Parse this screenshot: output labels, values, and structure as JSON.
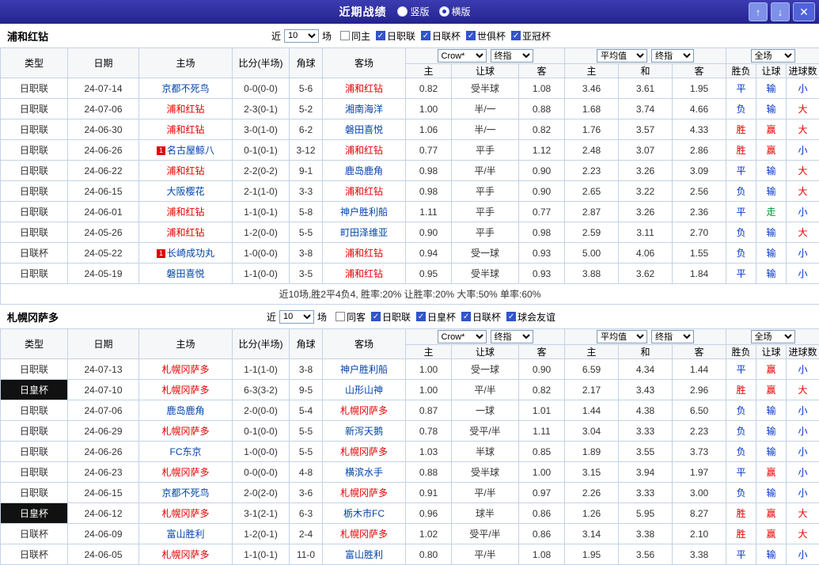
{
  "palette": {
    "topbar_bg": "#2b2b9c",
    "type_green": "#2e9e2e",
    "type_black": "#111111",
    "team_self_red": "#e50000",
    "team_opp_blue": "#0044aa",
    "score_red": "#e50000",
    "result_red": "#e50000",
    "result_blue": "#0033cc",
    "result_green": "#009933",
    "checkbox_blue": "#3355cc",
    "grid_border": "#c3d3e6"
  },
  "icons": {
    "check": "✓"
  },
  "titlebar": {
    "title": "近期战绩",
    "radios": [
      {
        "label": "竖版",
        "checked": false
      },
      {
        "label": "横版",
        "checked": true
      }
    ],
    "up_icon": "↑",
    "down_icon": "↓",
    "close_icon": "✕"
  },
  "sections": [
    {
      "team": "浦和红钻",
      "near_label": "近",
      "count": "10",
      "games_label": "场",
      "filters": [
        {
          "label": "同主",
          "checked": false
        },
        {
          "label": "日职联",
          "checked": true
        },
        {
          "label": "日联杯",
          "checked": true
        },
        {
          "label": "世俱杯",
          "checked": true
        },
        {
          "label": "亚冠杯",
          "checked": true
        }
      ],
      "header": {
        "cols": [
          "类型",
          "日期",
          "主场",
          "比分(半场)",
          "角球",
          "客场"
        ],
        "odds_selects": [
          "Crow*",
          "终指"
        ],
        "avg_selects": [
          "平均值",
          "终指"
        ],
        "full_select": "全场",
        "sub": [
          "主",
          "让球",
          "客",
          "主",
          "和",
          "客",
          "胜负",
          "让球",
          "进球数"
        ]
      },
      "rows": [
        {
          "type": "日职联",
          "type_dark": false,
          "date": "24-07-14",
          "home": "京都不死鸟",
          "home_self": false,
          "home_badge": "",
          "score": "0-0(0-0)",
          "corner": "5-6",
          "away": "浦和红钻",
          "away_self": true,
          "odds_home": "0.82",
          "handicap": "受半球",
          "odds_away": "1.08",
          "avg_home": "3.46",
          "avg_draw": "3.61",
          "avg_away": "1.95",
          "result": "平",
          "handicap_result": "输",
          "goals_result": "小"
        },
        {
          "type": "日职联",
          "type_dark": false,
          "date": "24-07-06",
          "home": "浦和红钻",
          "home_self": true,
          "home_badge": "",
          "score": "2-3(0-1)",
          "corner": "5-2",
          "away": "湘南海洋",
          "away_self": false,
          "odds_home": "1.00",
          "handicap": "半/一",
          "odds_away": "0.88",
          "avg_home": "1.68",
          "avg_draw": "3.74",
          "avg_away": "4.66",
          "result": "负",
          "handicap_result": "输",
          "goals_result": "大"
        },
        {
          "type": "日职联",
          "type_dark": false,
          "date": "24-06-30",
          "home": "浦和红钻",
          "home_self": true,
          "home_badge": "",
          "score": "3-0(1-0)",
          "corner": "6-2",
          "away": "磐田喜悦",
          "away_self": false,
          "odds_home": "1.06",
          "handicap": "半/一",
          "odds_away": "0.82",
          "avg_home": "1.76",
          "avg_draw": "3.57",
          "avg_away": "4.33",
          "result": "胜",
          "handicap_result": "赢",
          "goals_result": "大"
        },
        {
          "type": "日职联",
          "type_dark": false,
          "date": "24-06-26",
          "home": "名古屋鲸八",
          "home_self": false,
          "home_badge": "1",
          "score": "0-1(0-1)",
          "corner": "3-12",
          "away": "浦和红钻",
          "away_self": true,
          "odds_home": "0.77",
          "handicap": "平手",
          "odds_away": "1.12",
          "avg_home": "2.48",
          "avg_draw": "3.07",
          "avg_away": "2.86",
          "result": "胜",
          "handicap_result": "赢",
          "goals_result": "小"
        },
        {
          "type": "日职联",
          "type_dark": false,
          "date": "24-06-22",
          "home": "浦和红钻",
          "home_self": true,
          "home_badge": "",
          "score": "2-2(0-2)",
          "corner": "9-1",
          "away": "鹿岛鹿角",
          "away_self": false,
          "odds_home": "0.98",
          "handicap": "平/半",
          "odds_away": "0.90",
          "avg_home": "2.23",
          "avg_draw": "3.26",
          "avg_away": "3.09",
          "result": "平",
          "handicap_result": "输",
          "goals_result": "大"
        },
        {
          "type": "日职联",
          "type_dark": false,
          "date": "24-06-15",
          "home": "大阪樱花",
          "home_self": false,
          "home_badge": "",
          "score": "2-1(1-0)",
          "corner": "3-3",
          "away": "浦和红钻",
          "away_self": true,
          "odds_home": "0.98",
          "handicap": "平手",
          "odds_away": "0.90",
          "avg_home": "2.65",
          "avg_draw": "3.22",
          "avg_away": "2.56",
          "result": "负",
          "handicap_result": "输",
          "goals_result": "大"
        },
        {
          "type": "日职联",
          "type_dark": false,
          "date": "24-06-01",
          "home": "浦和红钻",
          "home_self": true,
          "home_badge": "",
          "score": "1-1(0-1)",
          "corner": "5-8",
          "away": "神户胜利船",
          "away_self": false,
          "odds_home": "1.11",
          "handicap": "平手",
          "odds_away": "0.77",
          "avg_home": "2.87",
          "avg_draw": "3.26",
          "avg_away": "2.36",
          "result": "平",
          "handicap_result": "走",
          "goals_result": "小"
        },
        {
          "type": "日职联",
          "type_dark": false,
          "date": "24-05-26",
          "home": "浦和红钻",
          "home_self": true,
          "home_badge": "",
          "score": "1-2(0-0)",
          "corner": "5-5",
          "away": "町田泽维亚",
          "away_self": false,
          "odds_home": "0.90",
          "handicap": "平手",
          "odds_away": "0.98",
          "avg_home": "2.59",
          "avg_draw": "3.11",
          "avg_away": "2.70",
          "result": "负",
          "handicap_result": "输",
          "goals_result": "大"
        },
        {
          "type": "日联杯",
          "type_dark": false,
          "date": "24-05-22",
          "home": "长崎成功丸",
          "home_self": false,
          "home_badge": "1",
          "score": "1-0(0-0)",
          "corner": "3-8",
          "away": "浦和红钻",
          "away_self": true,
          "odds_home": "0.94",
          "handicap": "受一球",
          "odds_away": "0.93",
          "avg_home": "5.00",
          "avg_draw": "4.06",
          "avg_away": "1.55",
          "result": "负",
          "handicap_result": "输",
          "goals_result": "小"
        },
        {
          "type": "日职联",
          "type_dark": false,
          "date": "24-05-19",
          "home": "磐田喜悦",
          "home_self": false,
          "home_badge": "",
          "score": "1-1(0-0)",
          "corner": "3-5",
          "away": "浦和红钻",
          "away_self": true,
          "odds_home": "0.95",
          "handicap": "受半球",
          "odds_away": "0.93",
          "avg_home": "3.88",
          "avg_draw": "3.62",
          "avg_away": "1.84",
          "result": "平",
          "handicap_result": "输",
          "goals_result": "小"
        }
      ],
      "summary": "近10场,胜2平4负4, 胜率:20% 让胜率:20% 大率:50% 单率:60%"
    },
    {
      "team": "札幌冈萨多",
      "near_label": "近",
      "count": "10",
      "games_label": "场",
      "filters": [
        {
          "label": "同客",
          "checked": false
        },
        {
          "label": "日职联",
          "checked": true
        },
        {
          "label": "日皇杯",
          "checked": true
        },
        {
          "label": "日联杯",
          "checked": true
        },
        {
          "label": "球会友谊",
          "checked": true
        }
      ],
      "header": {
        "cols": [
          "类型",
          "日期",
          "主场",
          "比分(半场)",
          "角球",
          "客场"
        ],
        "odds_selects": [
          "Crow*",
          "终指"
        ],
        "avg_selects": [
          "平均值",
          "终指"
        ],
        "full_select": "全场",
        "sub": [
          "主",
          "让球",
          "客",
          "主",
          "和",
          "客",
          "胜负",
          "让球",
          "进球数"
        ]
      },
      "rows": [
        {
          "type": "日职联",
          "type_dark": false,
          "date": "24-07-13",
          "home": "札幌冈萨多",
          "home_self": true,
          "home_badge": "",
          "score": "1-1(1-0)",
          "corner": "3-8",
          "away": "神户胜利船",
          "away_self": false,
          "odds_home": "1.00",
          "handicap": "受一球",
          "odds_away": "0.90",
          "avg_home": "6.59",
          "avg_draw": "4.34",
          "avg_away": "1.44",
          "result": "平",
          "handicap_result": "赢",
          "goals_result": "小"
        },
        {
          "type": "日皇杯",
          "type_dark": true,
          "date": "24-07-10",
          "home": "札幌冈萨多",
          "home_self": true,
          "home_badge": "",
          "score": "6-3(3-2)",
          "corner": "9-5",
          "away": "山形山神",
          "away_self": false,
          "odds_home": "1.00",
          "handicap": "平/半",
          "odds_away": "0.82",
          "avg_home": "2.17",
          "avg_draw": "3.43",
          "avg_away": "2.96",
          "result": "胜",
          "handicap_result": "赢",
          "goals_result": "大"
        },
        {
          "type": "日职联",
          "type_dark": false,
          "date": "24-07-06",
          "home": "鹿岛鹿角",
          "home_self": false,
          "home_badge": "",
          "score": "2-0(0-0)",
          "corner": "5-4",
          "away": "札幌冈萨多",
          "away_self": true,
          "odds_home": "0.87",
          "handicap": "一球",
          "odds_away": "1.01",
          "avg_home": "1.44",
          "avg_draw": "4.38",
          "avg_away": "6.50",
          "result": "负",
          "handicap_result": "输",
          "goals_result": "小"
        },
        {
          "type": "日职联",
          "type_dark": false,
          "date": "24-06-29",
          "home": "札幌冈萨多",
          "home_self": true,
          "home_badge": "",
          "score": "0-1(0-0)",
          "corner": "5-5",
          "away": "新泻天鹅",
          "away_self": false,
          "odds_home": "0.78",
          "handicap": "受平/半",
          "odds_away": "1.11",
          "avg_home": "3.04",
          "avg_draw": "3.33",
          "avg_away": "2.23",
          "result": "负",
          "handicap_result": "输",
          "goals_result": "小"
        },
        {
          "type": "日职联",
          "type_dark": false,
          "date": "24-06-26",
          "home": "FC东京",
          "home_self": false,
          "home_badge": "",
          "score": "1-0(0-0)",
          "corner": "5-5",
          "away": "札幌冈萨多",
          "away_self": true,
          "odds_home": "1.03",
          "handicap": "半球",
          "odds_away": "0.85",
          "avg_home": "1.89",
          "avg_draw": "3.55",
          "avg_away": "3.73",
          "result": "负",
          "handicap_result": "输",
          "goals_result": "小"
        },
        {
          "type": "日职联",
          "type_dark": false,
          "date": "24-06-23",
          "home": "札幌冈萨多",
          "home_self": true,
          "home_badge": "",
          "score": "0-0(0-0)",
          "corner": "4-8",
          "away": "横滨水手",
          "away_self": false,
          "odds_home": "0.88",
          "handicap": "受半球",
          "odds_away": "1.00",
          "avg_home": "3.15",
          "avg_draw": "3.94",
          "avg_away": "1.97",
          "result": "平",
          "handicap_result": "赢",
          "goals_result": "小"
        },
        {
          "type": "日职联",
          "type_dark": false,
          "date": "24-06-15",
          "home": "京都不死鸟",
          "home_self": false,
          "home_badge": "",
          "score": "2-0(2-0)",
          "corner": "3-6",
          "away": "札幌冈萨多",
          "away_self": true,
          "odds_home": "0.91",
          "handicap": "平/半",
          "odds_away": "0.97",
          "avg_home": "2.26",
          "avg_draw": "3.33",
          "avg_away": "3.00",
          "result": "负",
          "handicap_result": "输",
          "goals_result": "小"
        },
        {
          "type": "日皇杯",
          "type_dark": true,
          "date": "24-06-12",
          "home": "札幌冈萨多",
          "home_self": true,
          "home_badge": "",
          "score": "3-1(2-1)",
          "corner": "6-3",
          "away": "栃木市FC",
          "away_self": false,
          "odds_home": "0.96",
          "handicap": "球半",
          "odds_away": "0.86",
          "avg_home": "1.26",
          "avg_draw": "5.95",
          "avg_away": "8.27",
          "result": "胜",
          "handicap_result": "赢",
          "goals_result": "大"
        },
        {
          "type": "日联杯",
          "type_dark": false,
          "date": "24-06-09",
          "home": "富山胜利",
          "home_self": false,
          "home_badge": "",
          "score": "1-2(0-1)",
          "corner": "2-4",
          "away": "札幌冈萨多",
          "away_self": true,
          "odds_home": "1.02",
          "handicap": "受平/半",
          "odds_away": "0.86",
          "avg_home": "3.14",
          "avg_draw": "3.38",
          "avg_away": "2.10",
          "result": "胜",
          "handicap_result": "赢",
          "goals_result": "大"
        },
        {
          "type": "日联杯",
          "type_dark": false,
          "date": "24-06-05",
          "home": "札幌冈萨多",
          "home_self": true,
          "home_badge": "",
          "score": "1-1(0-1)",
          "corner": "11-0",
          "away": "富山胜利",
          "away_self": false,
          "odds_home": "0.80",
          "handicap": "平/半",
          "odds_away": "1.08",
          "avg_home": "1.95",
          "avg_draw": "3.56",
          "avg_away": "3.38",
          "result": "平",
          "handicap_result": "输",
          "goals_result": "小"
        }
      ],
      "summary": ""
    }
  ]
}
